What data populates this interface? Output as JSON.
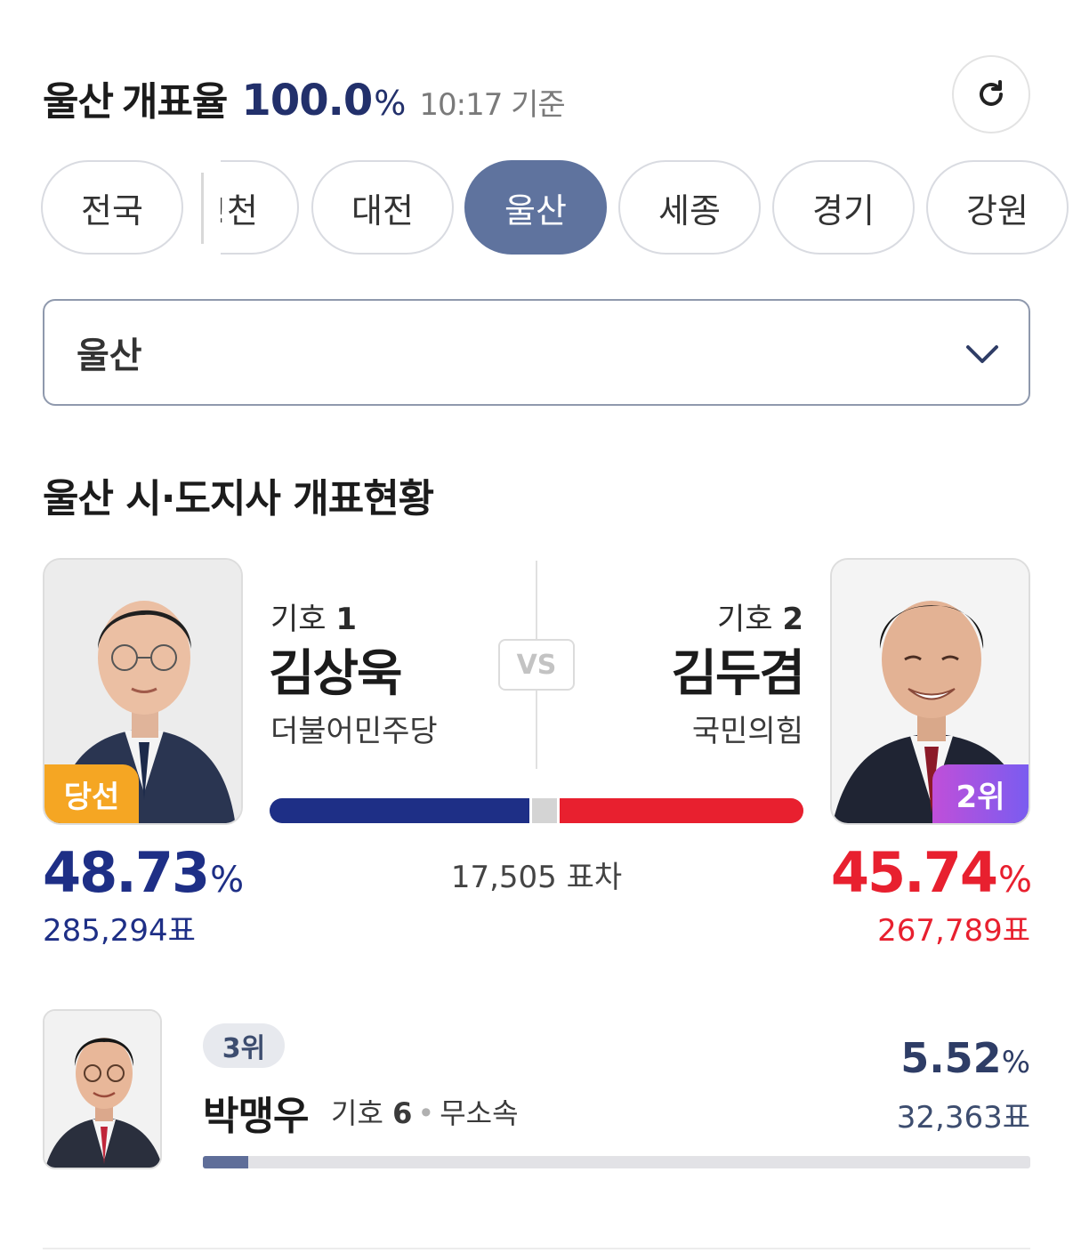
{
  "header": {
    "region": "울산",
    "label": "개표율",
    "rate": "100.0",
    "rate_unit": "%",
    "time": "10:17 기준"
  },
  "tabs": [
    {
      "label": "전국",
      "active": false
    },
    {
      "label": "인천",
      "visible_fragment": "!천",
      "active": false
    },
    {
      "label": "대전",
      "active": false
    },
    {
      "label": "울산",
      "active": true
    },
    {
      "label": "세종",
      "active": false
    },
    {
      "label": "경기",
      "active": false
    },
    {
      "label": "강원",
      "active": false
    }
  ],
  "select": {
    "value": "울산"
  },
  "section_title": "울산 시·도지사 개표현황",
  "candidate1": {
    "number_label": "기호",
    "number": "1",
    "name": "김상욱",
    "party": "더불어민주당",
    "badge": "당선",
    "percent": "48.73",
    "percent_unit": "%",
    "votes": "285,294표",
    "share": 48.73,
    "color": "#1e2f86"
  },
  "candidate2": {
    "number_label": "기호",
    "number": "2",
    "name": "김두겸",
    "party": "국민의힘",
    "badge": "2위",
    "percent": "45.74",
    "percent_unit": "%",
    "votes": "267,789표",
    "share": 45.74,
    "color": "#e8202f"
  },
  "vs": "VS",
  "difference": "17,505 표차",
  "candidate3": {
    "rank": "3위",
    "name": "박맹우",
    "number_label": "기호",
    "number": "6",
    "party": "무소속",
    "percent": "5.52",
    "percent_unit": "%",
    "votes": "32,363표",
    "share": 5.52,
    "color": "#5f6e99"
  }
}
